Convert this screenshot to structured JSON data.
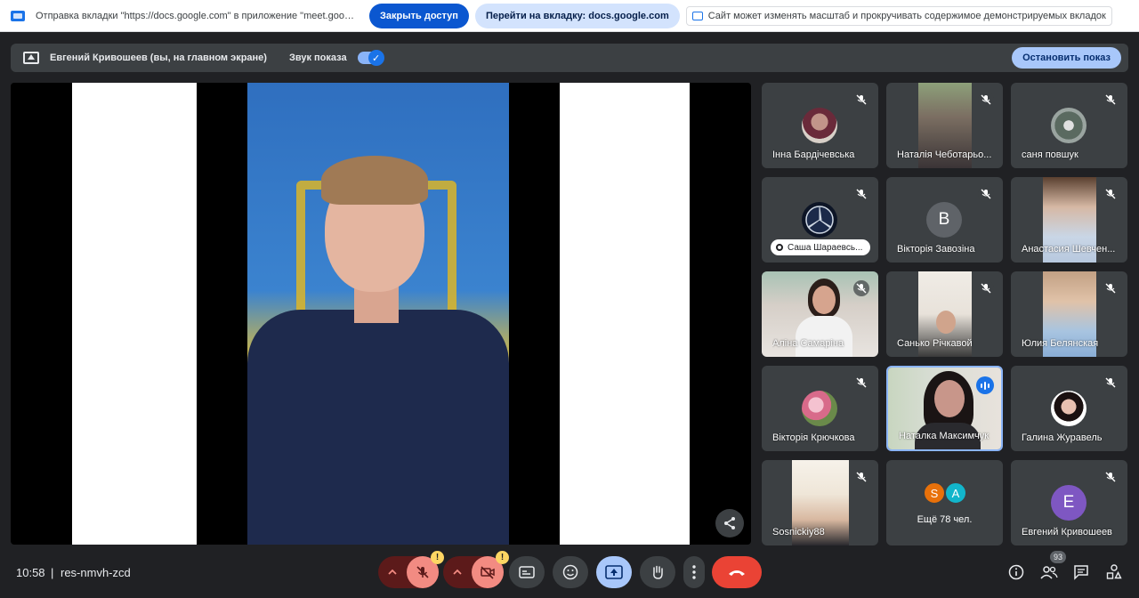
{
  "sharebar": {
    "text": "Отправка вкладки \"https://docs.google.com\" в приложение \"meet.google.com\"...",
    "stop_access": "Закрыть доступ",
    "switch_tab": "Перейти на вкладку: docs.google.com",
    "zoom_note": "Сайт может изменять масштаб и прокручивать содержимое демонстрируемых вкладок"
  },
  "presenting": {
    "name": "Евгений Кривошеев (вы, на главном экране)",
    "audio_label": "Звук показа",
    "stop_label": "Остановить показ"
  },
  "participants": [
    {
      "name": "Інна Бардічевська"
    },
    {
      "name": "Наталія Чеботарьо..."
    },
    {
      "name": "саня повшук"
    },
    {
      "name": "Саша Шараевсь..."
    },
    {
      "name": "Вікторія Завозіна",
      "letter": "В"
    },
    {
      "name": "Анастасия Шевчен..."
    },
    {
      "name": "Аліна Самаріна"
    },
    {
      "name": "Санькo Річкавой"
    },
    {
      "name": "Юлия Белянская"
    },
    {
      "name": "Вікторія Крючкова"
    },
    {
      "name": "Наталка Максимчук"
    },
    {
      "name": "Галина Журавель"
    },
    {
      "name": "Sosnickiy88"
    },
    {
      "name": "Ещё 78 чел.",
      "letters": [
        "S",
        "A"
      ]
    },
    {
      "name": "Евгений Кривошеев",
      "letter": "Е"
    }
  ],
  "bottom": {
    "time": "10:58",
    "separator": "|",
    "code": "res-nmvh-zcd",
    "warn": "!",
    "people_count": "93"
  },
  "colors": {
    "accent": "#1a73e8",
    "hangup": "#ea4335",
    "muted_red": "#f28b82"
  }
}
